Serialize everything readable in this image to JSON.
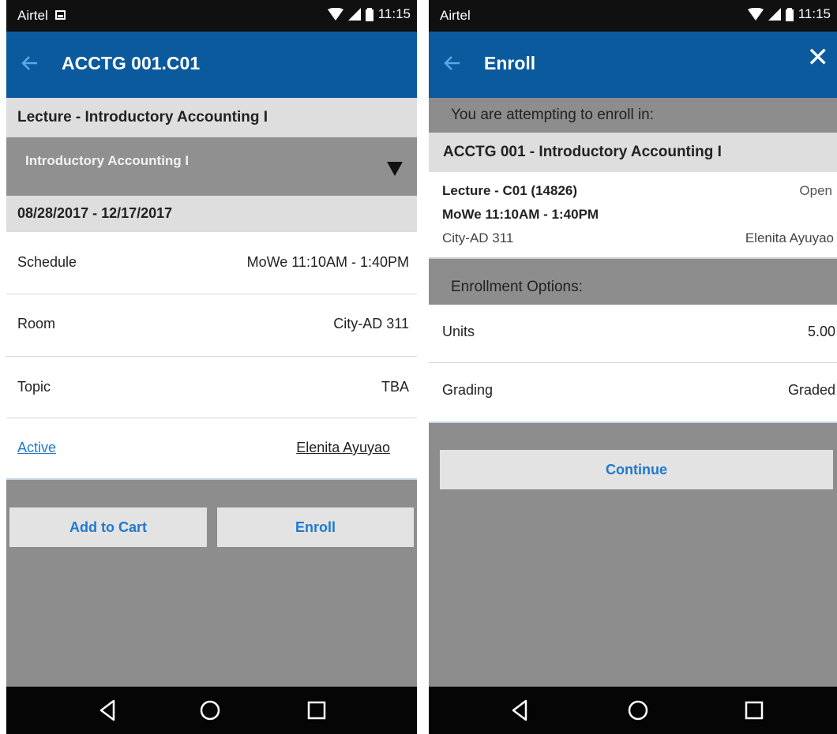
{
  "left": {
    "status": {
      "carrier": "Airtel",
      "time": "11:15"
    },
    "header": {
      "title": "ACCTG 001.C01"
    },
    "section_title": "Lecture - Introductory Accounting I",
    "dropdown": {
      "value": "Introductory Accounting I"
    },
    "dates": "08/28/2017 - 12/17/2017",
    "details": [
      {
        "label": "Schedule",
        "value": "MoWe 11:10AM - 1:40PM"
      },
      {
        "label": "Room",
        "value": "City-AD 311"
      },
      {
        "label": "Topic",
        "value": "TBA"
      }
    ],
    "status_link": "Active",
    "instructor_link": "Elenita Ayuyao",
    "buttons": {
      "add_to_cart": "Add to Cart",
      "enroll": "Enroll"
    }
  },
  "right": {
    "status": {
      "carrier": "Airtel",
      "time": "11:15"
    },
    "header": {
      "title": "Enroll",
      "close": "✕"
    },
    "attempting": "You are attempting to enroll in:",
    "course_title": "ACCTG 001 - Introductory Accounting I",
    "class": {
      "section": "Lecture - C01 (14826)",
      "availability": "Open",
      "schedule": "MoWe 11:10AM - 1:40PM",
      "room": "City-AD 311",
      "instructor": "Elenita Ayuyao"
    },
    "options_title": "Enrollment Options:",
    "options": [
      {
        "label": "Units",
        "value": "5.00"
      },
      {
        "label": "Grading",
        "value": "Graded"
      }
    ],
    "continue_label": "Continue"
  },
  "colors": {
    "appbar": "#0c5a9e",
    "link": "#1f78cf",
    "background_gray": "#8d8d8d"
  }
}
